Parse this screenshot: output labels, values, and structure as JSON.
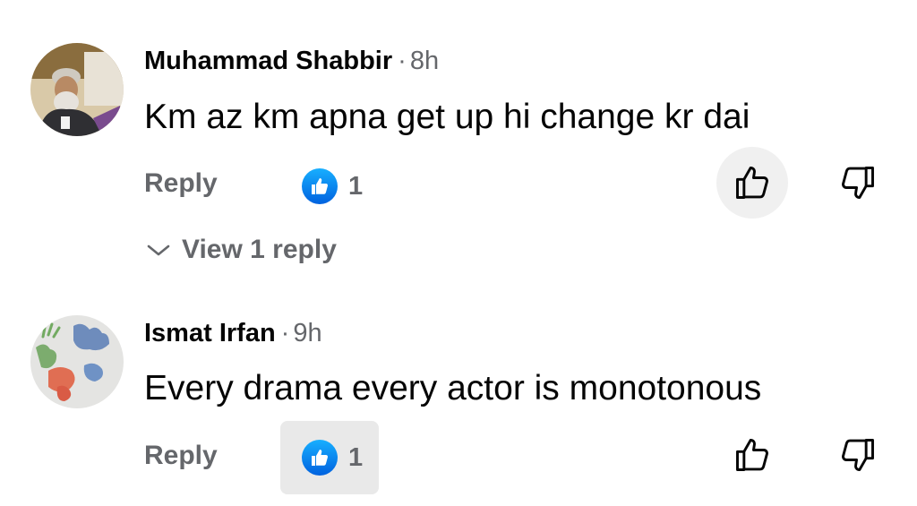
{
  "comments": [
    {
      "author": "Muhammad Shabbir",
      "separator": "·",
      "time": "8h",
      "text": "Km az km apna get up hi change kr dai",
      "reply_label": "Reply",
      "reaction_count": "1",
      "view_replies_label": "View 1 reply"
    },
    {
      "author": "Ismat Irfan",
      "separator": "·",
      "time": "9h",
      "text": "Every drama every actor is monotonous",
      "reply_label": "Reply",
      "reaction_count": "1"
    }
  ],
  "colors": {
    "secondary_text": "#65676b",
    "like_reaction_blue": "#1877f2",
    "highlight_bg": "#e9e9e9"
  }
}
